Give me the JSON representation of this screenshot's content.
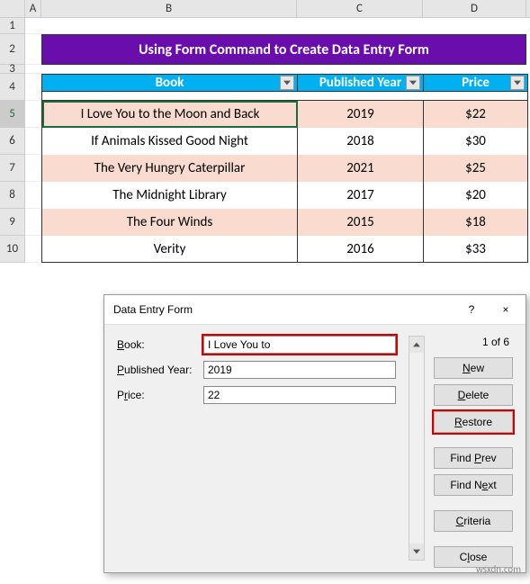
{
  "columns": [
    "A",
    "B",
    "C",
    "D"
  ],
  "rows": [
    "1",
    "2",
    "3",
    "4",
    "5",
    "6",
    "7",
    "8",
    "9",
    "10"
  ],
  "title": "Using Form Command to Create Data Entry Form",
  "table": {
    "headers": {
      "book": "Book",
      "year": "Published Year",
      "price": "Price"
    },
    "data": [
      {
        "book": "I Love You to the Moon and Back",
        "year": "2019",
        "price": "$22"
      },
      {
        "book": "If Animals Kissed Good Night",
        "year": "2018",
        "price": "$30"
      },
      {
        "book": "The Very Hungry Caterpillar",
        "year": "2021",
        "price": "$25"
      },
      {
        "book": "The Midnight Library",
        "year": "2017",
        "price": "$20"
      },
      {
        "book": "The Four Winds",
        "year": "2015",
        "price": "$18"
      },
      {
        "book": "Verity",
        "year": "2016",
        "price": "$33"
      }
    ]
  },
  "dialog": {
    "title": "Data Entry Form",
    "help": "?",
    "close": "×",
    "labels": {
      "book": "Book:",
      "year": "Published Year:",
      "price": "Price:"
    },
    "values": {
      "book": "I Love You to",
      "year": "2019",
      "price": "22"
    },
    "record": "1 of 6",
    "buttons": {
      "new": "New",
      "delete": "Delete",
      "restore": "Restore",
      "find_prev": "Find Prev",
      "find_next": "Find Next",
      "criteria": "Criteria",
      "close": "Close"
    }
  },
  "watermark": "wsxdn.com",
  "chart_data": {
    "type": "table",
    "columns": [
      "Book",
      "Published Year",
      "Price"
    ],
    "rows": [
      [
        "I Love You to the Moon and Back",
        2019,
        22
      ],
      [
        "If Animals Kissed Good Night",
        2018,
        30
      ],
      [
        "The Very Hungry Caterpillar",
        2021,
        25
      ],
      [
        "The Midnight Library",
        2017,
        20
      ],
      [
        "The Four Winds",
        2015,
        18
      ],
      [
        "Verity",
        2016,
        33
      ]
    ]
  }
}
